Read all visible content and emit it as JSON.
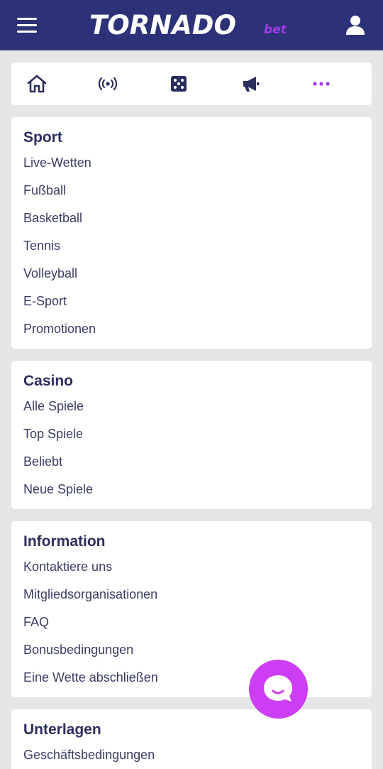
{
  "header": {
    "logo_main": "TORNADO",
    "logo_sub": "bet",
    "icons": {
      "menu": "hamburger-menu-icon",
      "user": "user-icon"
    }
  },
  "quicknav": {
    "items": [
      {
        "icon": "home-icon"
      },
      {
        "icon": "live-broadcast-icon"
      },
      {
        "icon": "dice-icon"
      },
      {
        "icon": "megaphone-icon"
      },
      {
        "icon": "more-dots-icon"
      }
    ]
  },
  "sections": [
    {
      "title": "Sport",
      "links": [
        "Live-Wetten",
        "Fußball",
        "Basketball",
        "Tennis",
        "Volleyball",
        "E-Sport",
        "Promotionen"
      ]
    },
    {
      "title": "Casino",
      "links": [
        "Alle Spiele",
        "Top Spiele",
        "Beliebt",
        "Neue Spiele"
      ]
    },
    {
      "title": "Information",
      "links": [
        "Kontaktiere uns",
        "Mitgliedsorganisationen",
        "FAQ",
        "Bonusbedingungen",
        "Eine Wette abschließen"
      ]
    },
    {
      "title": "Unterlagen",
      "links": [
        "Geschäftsbedingungen"
      ]
    }
  ],
  "chat": {
    "icon": "chat-bubble-icon"
  },
  "colors": {
    "header_bg": "#2d3278",
    "accent": "#a239e8",
    "chat_bg": "#cc3ef2",
    "page_bg": "#e6e6e6",
    "text_dark": "#2b2f5e"
  }
}
